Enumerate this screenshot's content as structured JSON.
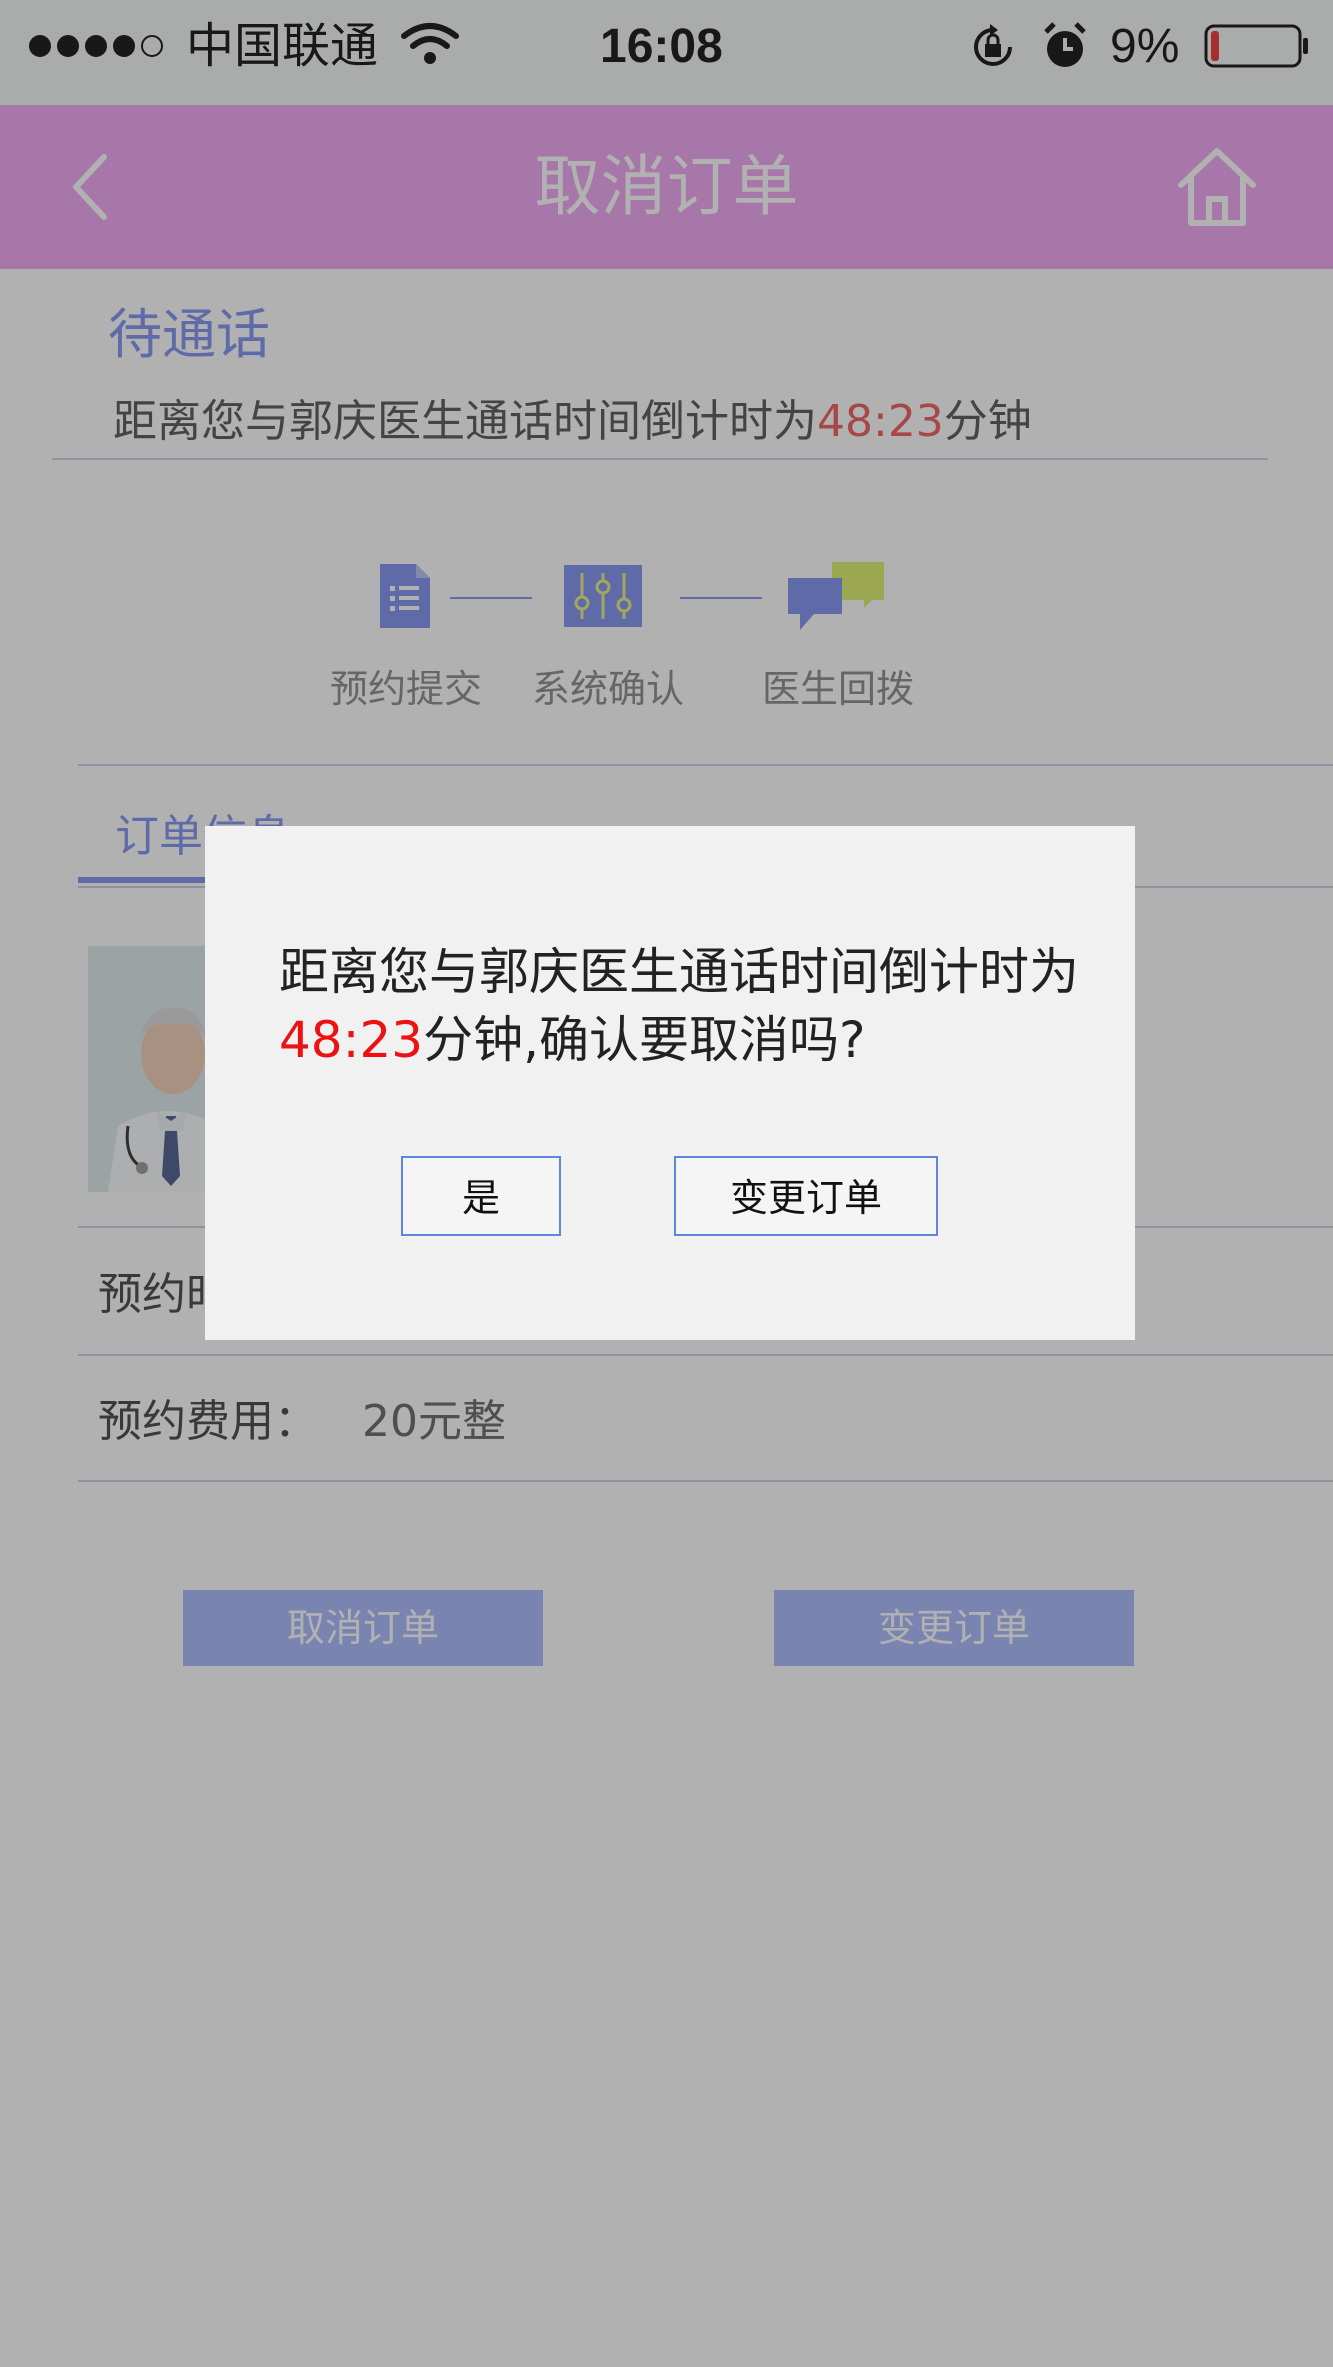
{
  "status_bar": {
    "carrier": "中国联通",
    "time": "16:08",
    "battery": "9%",
    "battery_level": 0.09
  },
  "header": {
    "title": "取消订单",
    "back_icon": "chevron-left-icon",
    "home_icon": "home-icon"
  },
  "order_status": {
    "title": "待通话",
    "countdown_prefix": "距离您与郭庆医生通话时间倒计时为",
    "countdown_value": "48:23",
    "countdown_suffix": "分钟"
  },
  "steps": [
    {
      "label": "预约提交",
      "icon": "document-list-icon"
    },
    {
      "label": "系统确认",
      "icon": "sliders-icon"
    },
    {
      "label": "医生回拨",
      "icon": "chat-bubbles-icon"
    }
  ],
  "tab": {
    "label": "订单信息"
  },
  "rows": {
    "time_label": "预约时间：",
    "fee_label": "预约费用：",
    "fee_value": "20元整"
  },
  "buttons": {
    "cancel": "取消订单",
    "change": "变更订单"
  },
  "dialog": {
    "message_prefix": "距离您与郭庆医生通话时间倒计时为",
    "countdown_value": "48:23",
    "message_suffix": "分钟,确认要取消吗?",
    "yes_label": "是",
    "change_label": "变更订单"
  },
  "colors": {
    "header": "#f0a4f2",
    "accent": "#7f91f1",
    "countdown": "#f05a5a",
    "dialog_border": "#5f86de"
  }
}
